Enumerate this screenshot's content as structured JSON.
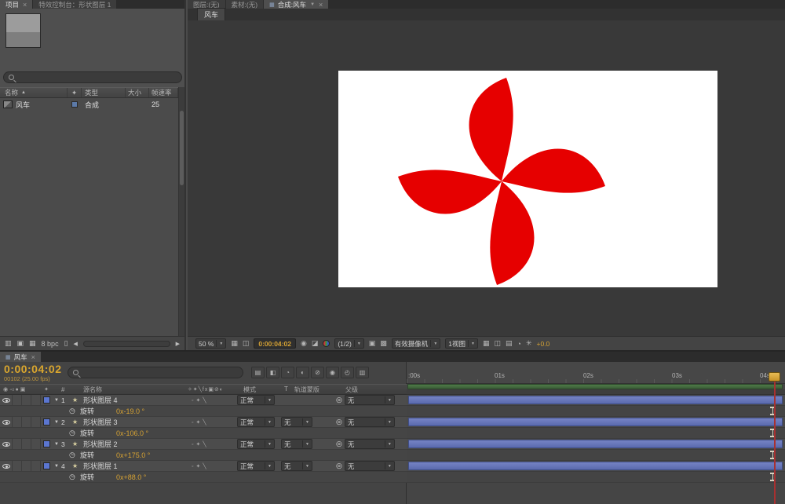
{
  "colors": {
    "pinwheel_red": "#e60000",
    "gold": "#d6a233",
    "layer_bar_blue": "#6474b8",
    "label_chip_blue": "#5b76d0",
    "work_area_green": "#42693f",
    "playhead_red": "#a83030"
  },
  "icons": {
    "close": "×",
    "dropdown": "▼",
    "sort_asc": "▲",
    "star": "★",
    "stopwatch": "◷",
    "pickwhip": "◎",
    "twirl": "▼",
    "fav": "✦",
    "hash": "#",
    "grid": "▦",
    "mask": "◫",
    "snapshot": "◉",
    "show_snapshot": "◪",
    "roi": "▣",
    "transparency": "▩",
    "interpret": "▥",
    "new_folder": "▣",
    "film": "▦",
    "trash": "▯",
    "left_arrow": "◀",
    "right_arrow": "▶",
    "flowchart": "▤",
    "draft3d": "◧",
    "shy": "◔",
    "frameblend": "◐",
    "motionblur": "⊘",
    "autokey": "◉",
    "graph": "◴",
    "extra": "▥",
    "exposure": "✳",
    "panel_menu": "≡"
  },
  "left_tabs": {
    "project": "项目",
    "effect_controls": "特效控制台：形状图层 1"
  },
  "viewer_tabs": {
    "layer": "图层:(无)",
    "footage": "素材:(无)",
    "comp": "合成:风车"
  },
  "project": {
    "columns": {
      "name": "名称",
      "type": "类型",
      "size": "大小",
      "fps": "帧速率"
    },
    "item": {
      "name": "风车",
      "type": "合成",
      "fps": "25"
    },
    "bpc": "8 bpc"
  },
  "viewer": {
    "tab": "风车",
    "zoom": "50 %",
    "timecode": "0:00:04:02",
    "resolution": "(1/2)",
    "camera": "有效摄像机",
    "views": "1视图",
    "exposure": "+0.0"
  },
  "timeline": {
    "tab": "风车",
    "timecode": "0:00:04:02",
    "frame_info": "00102 (25.00 fps)",
    "columns": {
      "source_name": "源名称",
      "mode": "模式",
      "t": "T",
      "trkmat": "轨道蒙版",
      "parent": "父级"
    },
    "header_av_glyphs": "◉◅●▣",
    "header_sw_glyphs": "✧✦╲fx▣⊘◐",
    "switch_glyphs": "◦✦╲",
    "rotation_label": "旋转",
    "ruler": [
      ":00s",
      "01s",
      "02s",
      "03s",
      "04s"
    ],
    "layers": [
      {
        "index": "1",
        "name": "形状图层 4",
        "mode": "正常",
        "parent": "无",
        "rotation": "0x-19.0 °"
      },
      {
        "index": "2",
        "name": "形状图层 3",
        "mode": "正常",
        "trkmat": "无",
        "parent": "无",
        "rotation": "0x-106.0 °"
      },
      {
        "index": "3",
        "name": "形状图层 2",
        "mode": "正常",
        "trkmat": "无",
        "parent": "无",
        "rotation": "0x+175.0 °"
      },
      {
        "index": "4",
        "name": "形状图层 1",
        "mode": "正常",
        "trkmat": "无",
        "parent": "无",
        "rotation": "0x+88.0 °"
      }
    ]
  }
}
